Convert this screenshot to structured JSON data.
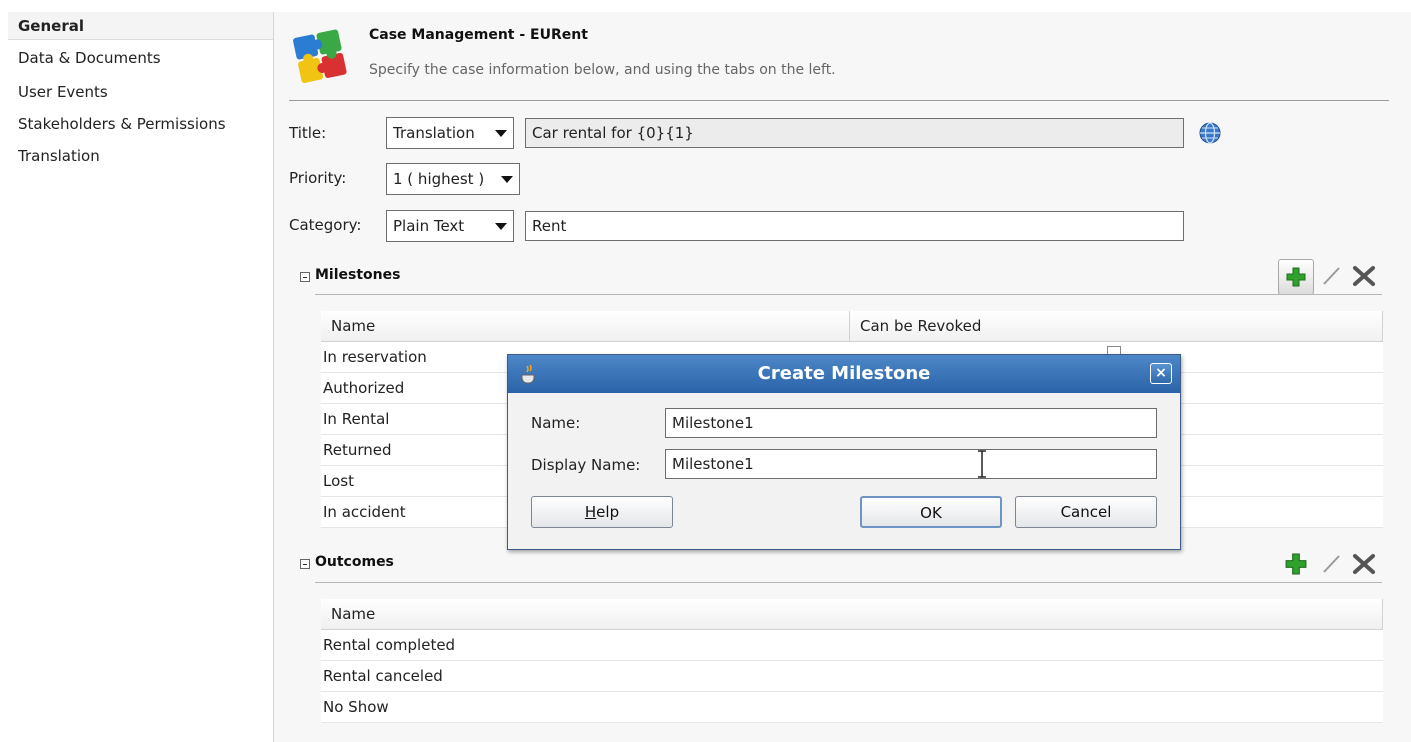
{
  "nav": {
    "items": [
      {
        "label": "General",
        "active": true
      },
      {
        "label": "Data & Documents",
        "active": false
      },
      {
        "label": "User Events",
        "active": false
      },
      {
        "label": "Stakeholders & Permissions",
        "active": false
      },
      {
        "label": "Translation",
        "active": false
      }
    ]
  },
  "header": {
    "title": "Case Management - EURent",
    "subtitle": "Specify the case information below, and using the tabs on the left."
  },
  "form": {
    "title_label": "Title:",
    "title_mode": "Translation",
    "title_value": "Car rental for {0}{1}",
    "priority_label": "Priority:",
    "priority_value": "1 ( highest )",
    "category_label": "Category:",
    "category_mode": "Plain Text",
    "category_value": "Rent"
  },
  "milestones": {
    "title": "Milestones",
    "columns": [
      "Name",
      "Can be Revoked"
    ],
    "rows": [
      "In reservation",
      "Authorized",
      "In Rental",
      "Returned",
      "Lost",
      "In accident"
    ]
  },
  "outcomes": {
    "title": "Outcomes",
    "columns": [
      "Name"
    ],
    "rows": [
      "Rental completed",
      "Rental canceled",
      "No Show"
    ]
  },
  "dialog": {
    "title": "Create Milestone",
    "name_label": "Name:",
    "name_value": "Milestone1",
    "display_name_label": "Display Name:",
    "display_name_value": "Milestone1",
    "help_label": "Help",
    "ok_label": "OK",
    "cancel_label": "Cancel"
  },
  "colors": {
    "dialog_title_bar": "#3670b4",
    "add_icon": "#2fa12c",
    "delete_icon": "#555555"
  },
  "icons": [
    "puzzle-logo-icon",
    "globe-icon",
    "add-icon",
    "edit-icon",
    "delete-icon",
    "close-icon",
    "coffee-cup-icon",
    "text-cursor-icon"
  ]
}
